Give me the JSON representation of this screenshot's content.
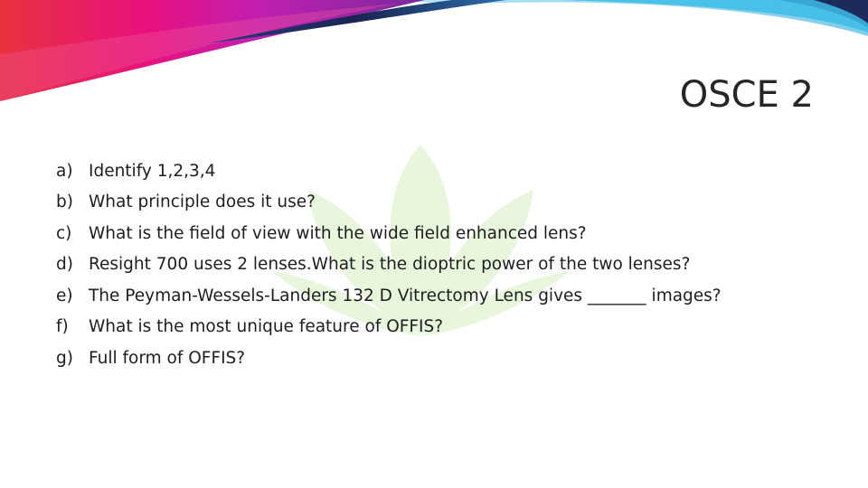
{
  "slide": {
    "title": "OSCE 2",
    "questions": [
      {
        "marker": "a)",
        "text": "Identify 1,2,3,4"
      },
      {
        "marker": "b)",
        "text": "What principle does it use?"
      },
      {
        "marker": "c)",
        "text": "What is the field of view with the wide field enhanced lens?"
      },
      {
        "marker": "d)",
        "text": "Resight 700 uses 2 lenses.What is the dioptric power of the two lenses?"
      },
      {
        "marker": "e)",
        "text": "The Peyman-Wessels-Landers 132 D Vitrectomy Lens gives _______ images?"
      },
      {
        "marker": "f)",
        "text": "What is the most unique feature of OFFIS?"
      },
      {
        "marker": "g)",
        "text": "Full form of OFFIS?"
      }
    ]
  },
  "colors": {
    "wave_pink": "#e8117f",
    "wave_red": "#e53340",
    "wave_navy": "#1d2a5c",
    "wave_cyan": "#2bb3e0",
    "lotus_green": "#d9f0c4",
    "text": "#1e1e1e"
  }
}
